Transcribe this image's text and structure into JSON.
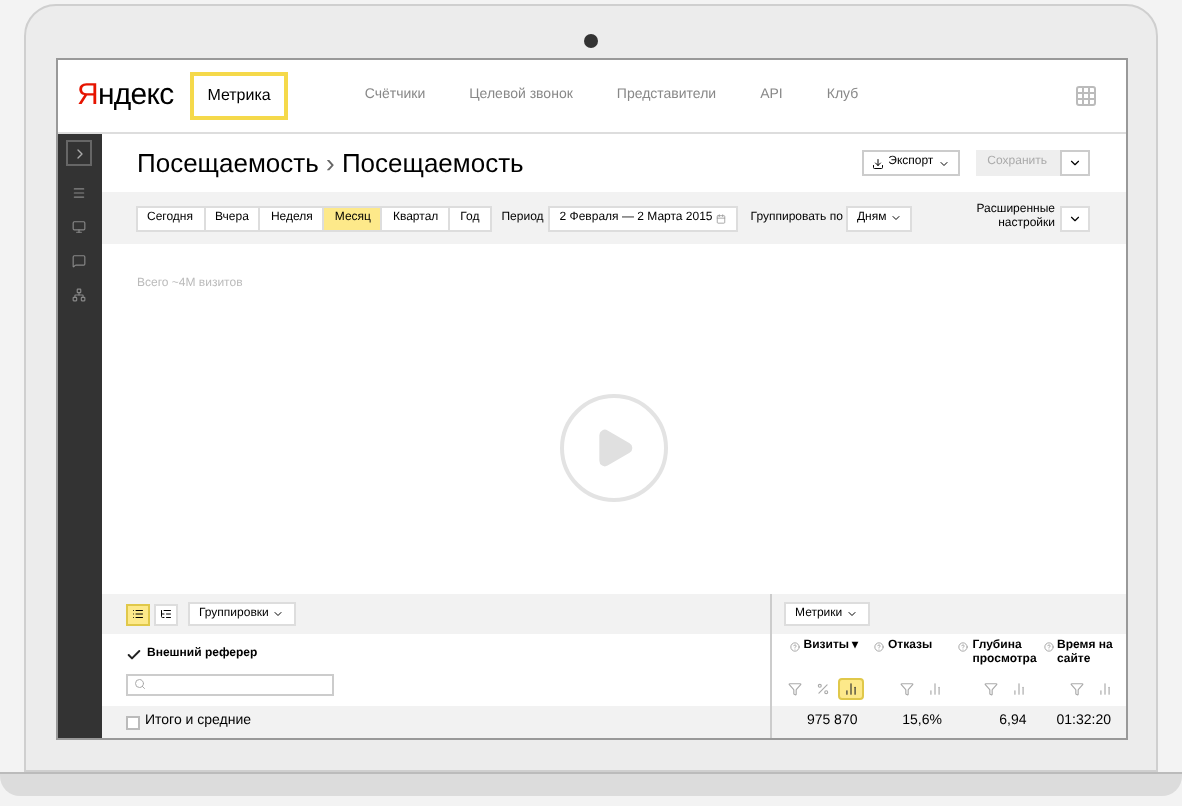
{
  "header": {
    "logo": "Яндекс",
    "product": "Метрика",
    "nav": [
      "Счётчики",
      "Целевой звонок",
      "Представители",
      "API",
      "Клуб"
    ]
  },
  "title": {
    "section": "Посещаемость",
    "separator": "›",
    "page": "Посещаемость"
  },
  "actions": {
    "export": "Экспорт",
    "save": {
      "label": "Сохранить",
      "disabled": true
    }
  },
  "periods": [
    {
      "label": "Сегодня",
      "selected": false
    },
    {
      "label": "Вчера",
      "selected": false
    },
    {
      "label": "Неделя",
      "selected": false
    },
    {
      "label": "Месяц",
      "selected": true
    },
    {
      "label": "Квартал",
      "selected": false
    },
    {
      "label": "Год",
      "selected": false
    }
  ],
  "period": {
    "label": "Период",
    "value": "2 Февраля — 2 Марта 2015"
  },
  "group_by": {
    "label": "Группировать по",
    "value": "Дням"
  },
  "advanced": "Расширенные настройки",
  "summary": "Всего ~4М визитов",
  "table": {
    "view_modes": [
      {
        "kind": "list",
        "selected": true
      },
      {
        "kind": "tree",
        "selected": false
      }
    ],
    "groupings_button": "Группировки",
    "metrics_button": "Метрики",
    "dimension": {
      "label": "Внешний реферер",
      "checked": true
    },
    "columns": [
      {
        "label": "Визиты",
        "sort_mark": "▾",
        "tools": [
          {
            "kind": "filter",
            "selected": false
          },
          {
            "kind": "percent",
            "selected": false
          },
          {
            "kind": "chart",
            "selected": true
          }
        ]
      },
      {
        "label": "Отказы",
        "tools": [
          {
            "kind": "filter",
            "selected": false
          },
          {
            "kind": "chart",
            "selected": false
          }
        ]
      },
      {
        "label": "Глубина просмотра",
        "tools": [
          {
            "kind": "filter",
            "selected": false
          },
          {
            "kind": "chart",
            "selected": false
          }
        ]
      },
      {
        "label": "Время на сайте",
        "tools": [
          {
            "kind": "filter",
            "selected": false
          },
          {
            "kind": "chart",
            "selected": false
          }
        ]
      }
    ],
    "total_row": {
      "label": "Итого и средние",
      "checked": false,
      "values": [
        "975 870",
        "15,6%",
        "6,94",
        "01:32:20"
      ]
    }
  }
}
